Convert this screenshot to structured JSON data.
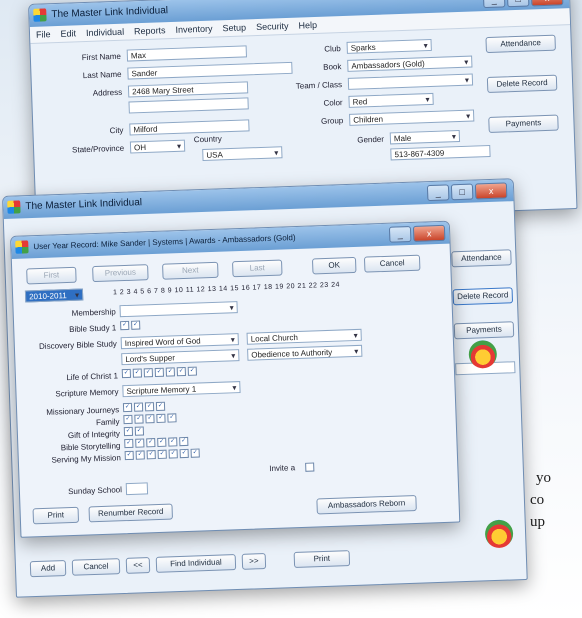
{
  "back_window": {
    "title": "The Master Link Individual",
    "menu": [
      "File",
      "Edit",
      "Individual",
      "Reports",
      "Inventory",
      "Setup",
      "Security",
      "Help"
    ],
    "labels": {
      "first_name": "First Name",
      "last_name": "Last Name",
      "address": "Address",
      "city": "City",
      "state": "State/Province",
      "country": "Country",
      "club": "Club",
      "book": "Book",
      "team": "Team / Class",
      "color": "Color",
      "group": "Group",
      "gender": "Gender"
    },
    "values": {
      "first_name": "Max",
      "last_name": "Sander",
      "address": "2468 Mary Street",
      "city": "Milford",
      "state": "OH",
      "country": "USA",
      "club": "Sparks",
      "book": "Ambassadors (Gold)",
      "color": "Red",
      "group": "Children",
      "gender": "Male",
      "phone": "513-867-4309"
    },
    "buttons": [
      "Attendance",
      "Delete Record",
      "Payments"
    ],
    "controls": {
      "min": "_",
      "max": "□",
      "close": "x"
    }
  },
  "front_window": {
    "title": "The Master Link Individual",
    "controls": {
      "min": "_",
      "max": "□",
      "close": "x"
    },
    "side_buttons": [
      "Attendance",
      "Delete Record",
      "Payments"
    ],
    "bottom_buttons": {
      "add": "Add",
      "cancel": "Cancel",
      "prev": "<<",
      "find": "Find Individual",
      "next": ">>",
      "print": "Print"
    }
  },
  "dialog": {
    "title": "User Year Record: Mike Sander | Systems | Awards - Ambassadors (Gold)",
    "nav_buttons": [
      "First",
      "Previous",
      "Next",
      "Last"
    ],
    "ok": "OK",
    "cancel": "Cancel",
    "year_select": "2010-2011",
    "week_numbers": "1  2  3  4  5  6  7  8  9  10  11  12  13  14  15  16  17  18  19  20  21  22  23  24",
    "rows": [
      {
        "label": "Membership",
        "value": ""
      },
      {
        "label": "Bible Study 1",
        "value": ""
      },
      {
        "label": "Discovery Bible Study",
        "value": "Inspired Word of God"
      },
      {
        "label": "",
        "value": "Lord's Supper"
      },
      {
        "label": "Life of Christ 1",
        "value": ""
      },
      {
        "label": "Scripture Memory",
        "value": "Scripture Memory 1"
      },
      {
        "label": "Missionary Journeys",
        "value": ""
      },
      {
        "label": "Family",
        "value": ""
      },
      {
        "label": "Gift of Integrity",
        "value": ""
      },
      {
        "label": "Bible Storytelling",
        "value": ""
      },
      {
        "label": "Serving My Mission",
        "value": ""
      }
    ],
    "right_selects": [
      "Local Church",
      "Obedience to Authority"
    ],
    "sunday_school": "Sunday School",
    "invite_label": "Invite a",
    "buttons": {
      "print": "Print",
      "renumber": "Renumber Record",
      "ambassadors": "Ambassadors Reborn"
    }
  },
  "background_text": [
    "yo",
    "co",
    "up"
  ]
}
